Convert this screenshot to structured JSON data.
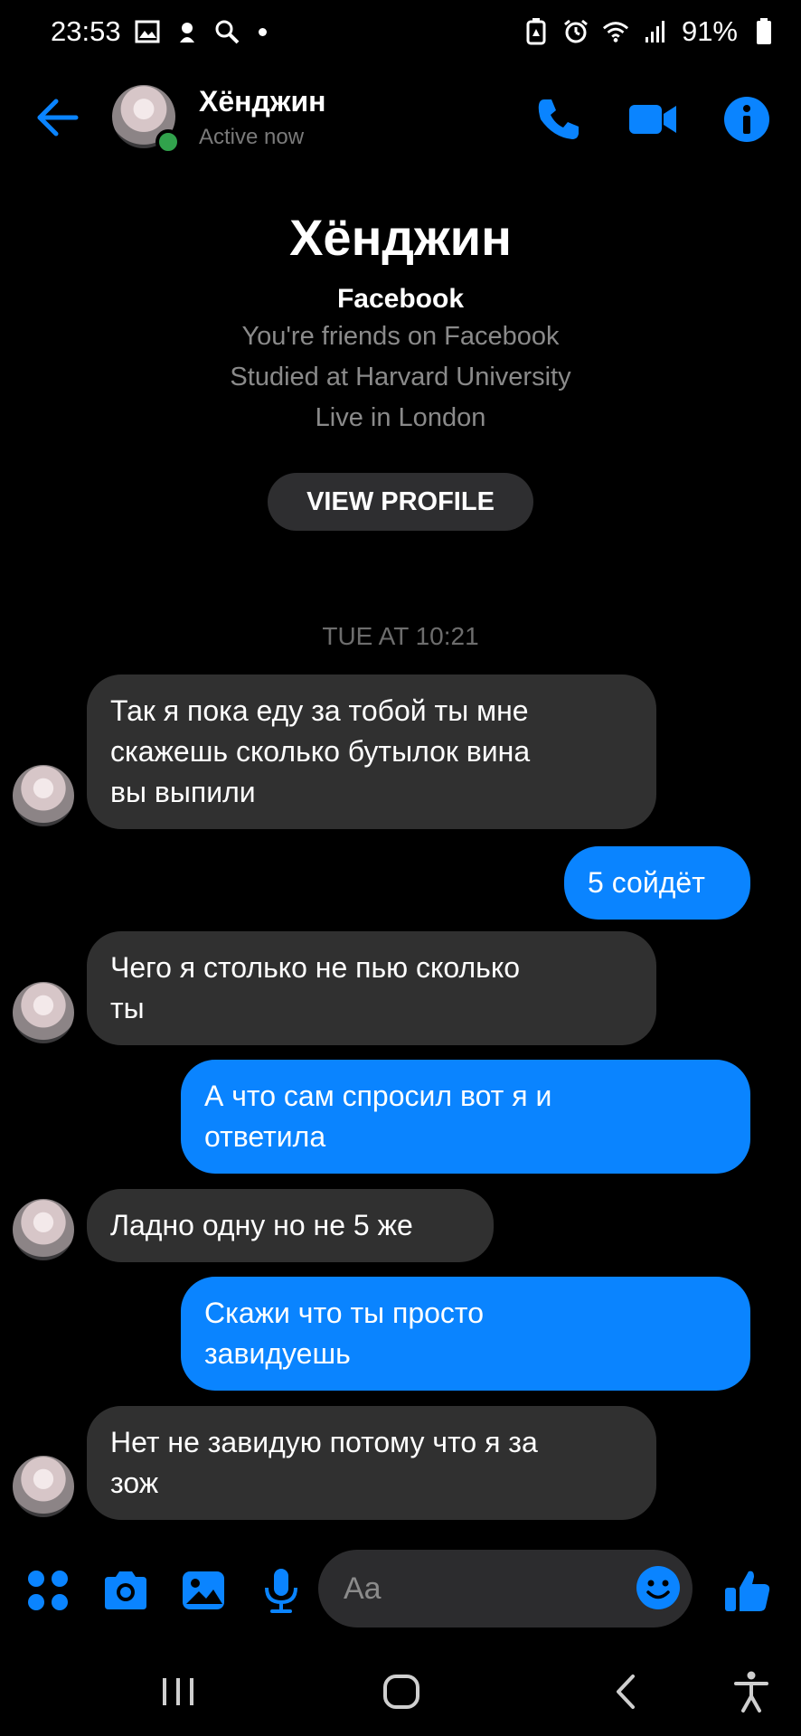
{
  "status_bar": {
    "time": "23:53",
    "battery": "91%",
    "icons": [
      "gallery-icon",
      "fan-icon",
      "search-icon",
      "notification-dot",
      "battery-saver-icon",
      "alarm-icon",
      "wifi-icon",
      "signal-icon",
      "battery-icon"
    ]
  },
  "header": {
    "name": "Хёнджин",
    "status": "Active now",
    "accent_color": "#0a84ff",
    "online_color": "#31a24c"
  },
  "profile": {
    "name": "Хёнджин",
    "network": "Facebook",
    "lines": [
      "You're friends on Facebook",
      "Studied at Harvard University",
      "Live in London"
    ],
    "button": "VIEW PROFILE"
  },
  "timestamp": "TUE AT 10:21",
  "messages": [
    {
      "side": "incoming",
      "lines": [
        "Так я пока еду за тобой ты мне",
        "скажешь сколько бутылок вина",
        "вы выпили"
      ]
    },
    {
      "side": "outgoing",
      "lines": [
        "5 сойдёт"
      ]
    },
    {
      "side": "incoming",
      "lines": [
        "Чего я столько не пью сколько",
        "ты"
      ]
    },
    {
      "side": "outgoing",
      "lines": [
        "А что сам спросил вот я и",
        "ответила"
      ]
    },
    {
      "side": "incoming",
      "lines": [
        "Ладно одну но не 5 же"
      ]
    },
    {
      "side": "outgoing",
      "lines": [
        "Скажи что ты просто",
        "завидуешь"
      ]
    },
    {
      "side": "incoming",
      "lines": [
        "Нет не завидую потому что я за",
        "зож"
      ]
    }
  ],
  "composer": {
    "placeholder": "Aa",
    "icons": [
      "apps-icon",
      "camera-icon",
      "gallery-icon",
      "mic-icon",
      "emoji-icon",
      "like-icon"
    ]
  },
  "nav_bar": {
    "icons": [
      "recents-icon",
      "home-icon",
      "back-icon",
      "accessibility-icon"
    ]
  },
  "colors": {
    "background": "#000000",
    "incoming_bubble": "#303030",
    "outgoing_bubble": "#0a84ff"
  }
}
